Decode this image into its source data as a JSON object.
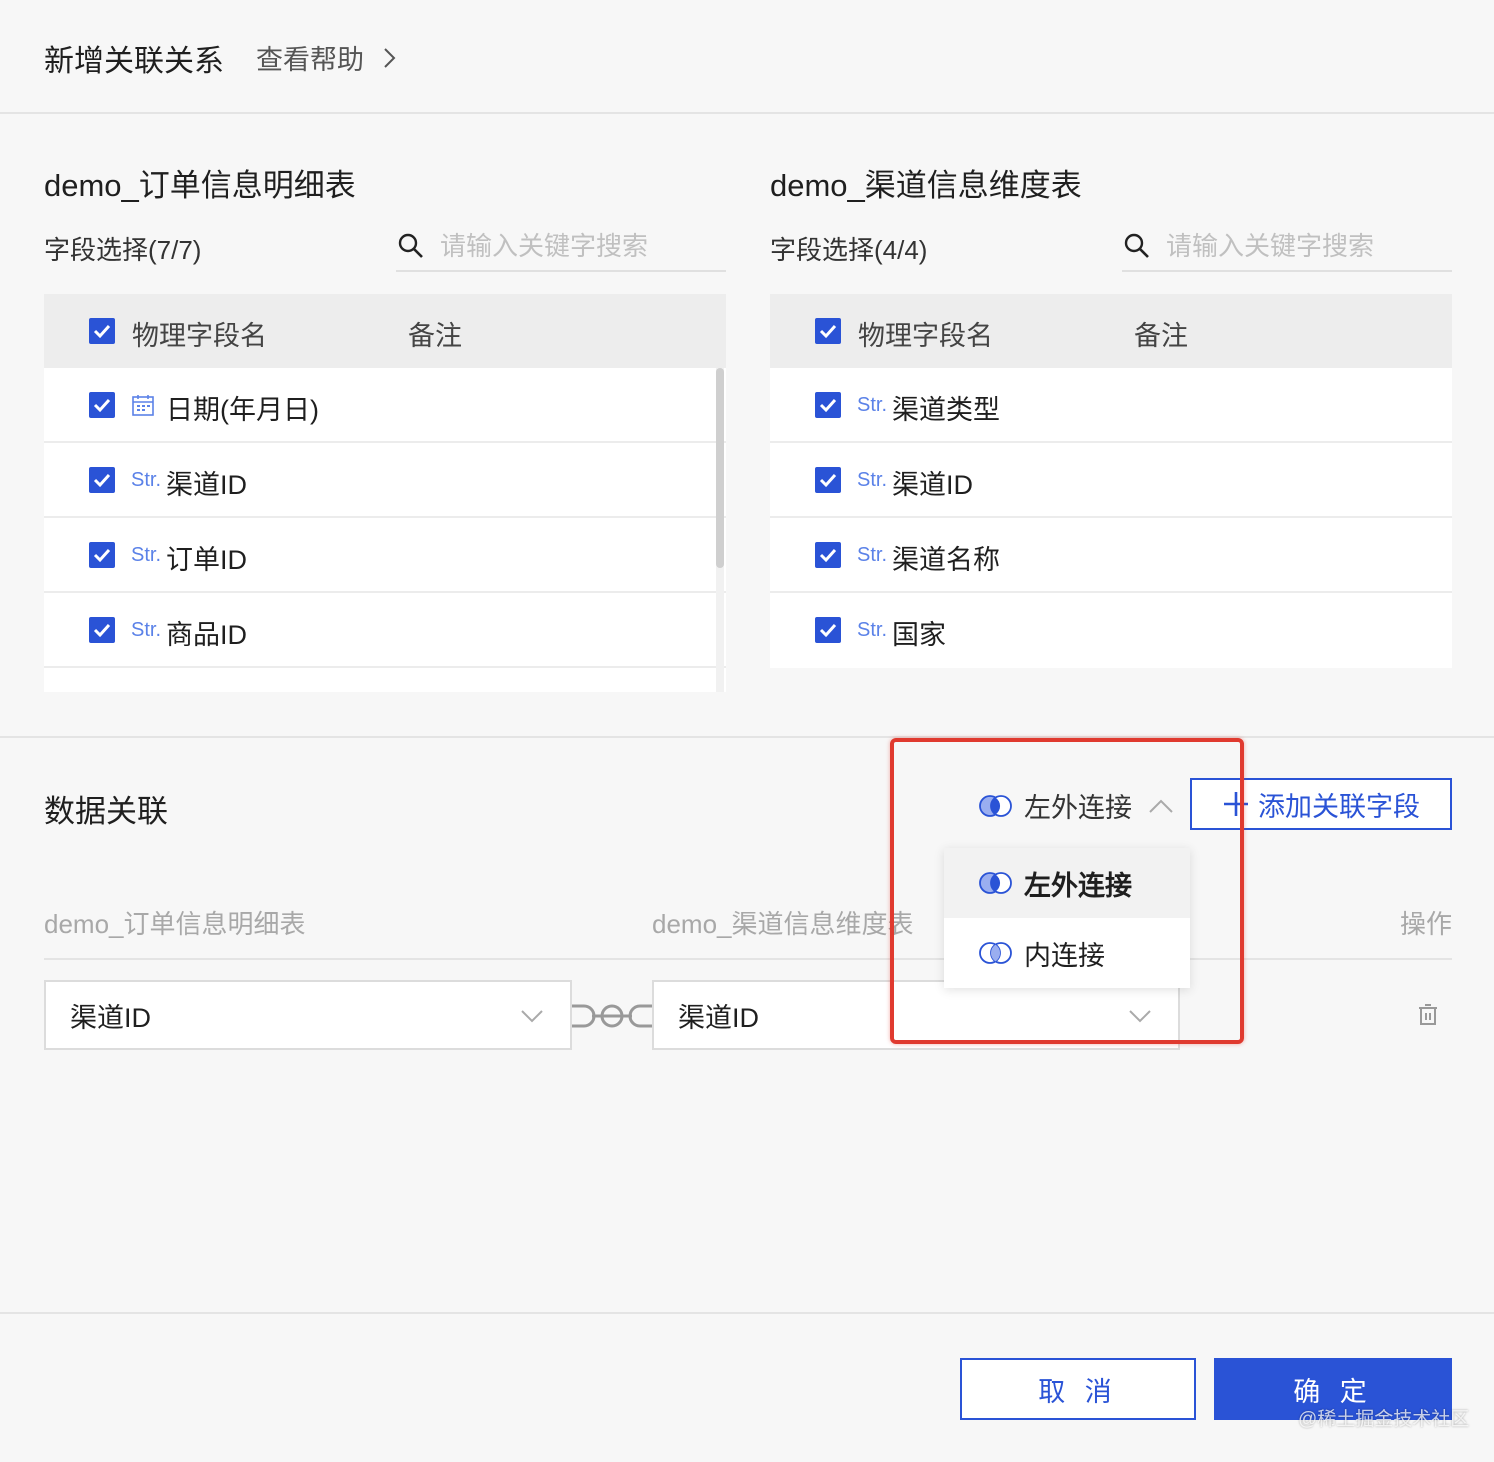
{
  "header": {
    "title": "新增关联关系",
    "help_link": "查看帮助"
  },
  "left_table": {
    "title": "demo_订单信息明细表",
    "field_select_label": "字段选择(7/7)",
    "search_placeholder": "请输入关键字搜索",
    "columns": [
      "物理字段名",
      "备注"
    ],
    "rows": [
      {
        "type": "date",
        "name": "日期(年月日)"
      },
      {
        "type": "Str.",
        "name": "渠道ID"
      },
      {
        "type": "Str.",
        "name": "订单ID"
      },
      {
        "type": "Str.",
        "name": "商品ID"
      }
    ]
  },
  "right_table": {
    "title": "demo_渠道信息维度表",
    "field_select_label": "字段选择(4/4)",
    "search_placeholder": "请输入关键字搜索",
    "columns": [
      "物理字段名",
      "备注"
    ],
    "rows": [
      {
        "type": "Str.",
        "name": "渠道类型"
      },
      {
        "type": "Str.",
        "name": "渠道ID"
      },
      {
        "type": "Str.",
        "name": "渠道名称"
      },
      {
        "type": "Str.",
        "name": "国家"
      }
    ]
  },
  "relation": {
    "title": "数据关联",
    "join_type": "左外连接",
    "add_button": "添加关联字段",
    "col_left": "demo_订单信息明细表",
    "col_right": "demo_渠道信息维度表",
    "col_action": "操作",
    "left_field": "渠道ID",
    "right_field": "渠道ID",
    "dropdown_options": [
      "左外连接",
      "内连接"
    ]
  },
  "footer": {
    "cancel": "取 消",
    "ok": "确 定"
  },
  "watermark": "@稀土掘金技术社区",
  "colors": {
    "primary": "#2a53d6",
    "highlight": "#e03a2f"
  }
}
